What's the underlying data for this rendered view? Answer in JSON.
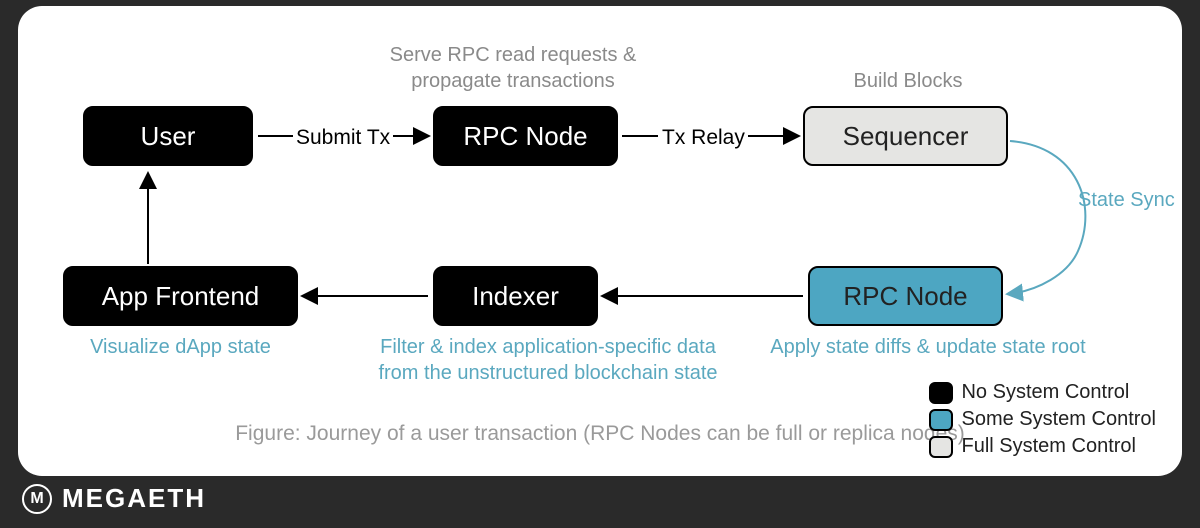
{
  "brand": {
    "mark": "M",
    "name": "MEGAETH"
  },
  "caption": "Figure: Journey of a user transaction (RPC Nodes can be full or replica nodes)",
  "nodes": {
    "user": {
      "label": "User"
    },
    "rpc_top": {
      "label": "RPC Node",
      "note_l1": "Serve RPC read requests &",
      "note_l2": "propagate transactions"
    },
    "sequencer": {
      "label": "Sequencer",
      "note": "Build Blocks"
    },
    "rpc_bottom": {
      "label": "RPC Node",
      "note": "Apply state diffs & update state root"
    },
    "indexer": {
      "label": "Indexer",
      "note_l1": "Filter & index application-specific data",
      "note_l2": "from the unstructured blockchain state"
    },
    "app_frontend": {
      "label": "App Frontend",
      "note": "Visualize dApp state"
    }
  },
  "edges": {
    "submit_tx": "Submit Tx",
    "tx_relay": "Tx Relay",
    "state_sync": "State Sync"
  },
  "legend": {
    "no_control": "No System Control",
    "some_control": "Some System Control",
    "full_control": "Full System Control"
  },
  "chart_data": {
    "type": "diagram",
    "title": "Journey of a user transaction (RPC Nodes can be full or replica nodes)",
    "nodes": [
      {
        "id": "user",
        "label": "User",
        "system_control": "none"
      },
      {
        "id": "rpc_top",
        "label": "RPC Node",
        "system_control": "none",
        "desc": "Serve RPC read requests & propagate transactions"
      },
      {
        "id": "sequencer",
        "label": "Sequencer",
        "system_control": "full",
        "desc": "Build Blocks"
      },
      {
        "id": "rpc_bottom",
        "label": "RPC Node",
        "system_control": "some",
        "desc": "Apply state diffs & update state root"
      },
      {
        "id": "indexer",
        "label": "Indexer",
        "system_control": "none",
        "desc": "Filter & index application-specific data from the unstructured blockchain state"
      },
      {
        "id": "app_frontend",
        "label": "App Frontend",
        "system_control": "none",
        "desc": "Visualize dApp state"
      }
    ],
    "edges": [
      {
        "from": "user",
        "to": "rpc_top",
        "label": "Submit Tx"
      },
      {
        "from": "rpc_top",
        "to": "sequencer",
        "label": "Tx Relay"
      },
      {
        "from": "sequencer",
        "to": "rpc_bottom",
        "label": "State Sync"
      },
      {
        "from": "rpc_bottom",
        "to": "indexer",
        "label": ""
      },
      {
        "from": "indexer",
        "to": "app_frontend",
        "label": ""
      },
      {
        "from": "app_frontend",
        "to": "user",
        "label": ""
      }
    ],
    "legend": [
      {
        "color": "#000000",
        "meaning": "No System Control"
      },
      {
        "color": "#4da6c2",
        "meaning": "Some System Control"
      },
      {
        "color": "#e5e5e3",
        "meaning": "Full System Control"
      }
    ]
  }
}
